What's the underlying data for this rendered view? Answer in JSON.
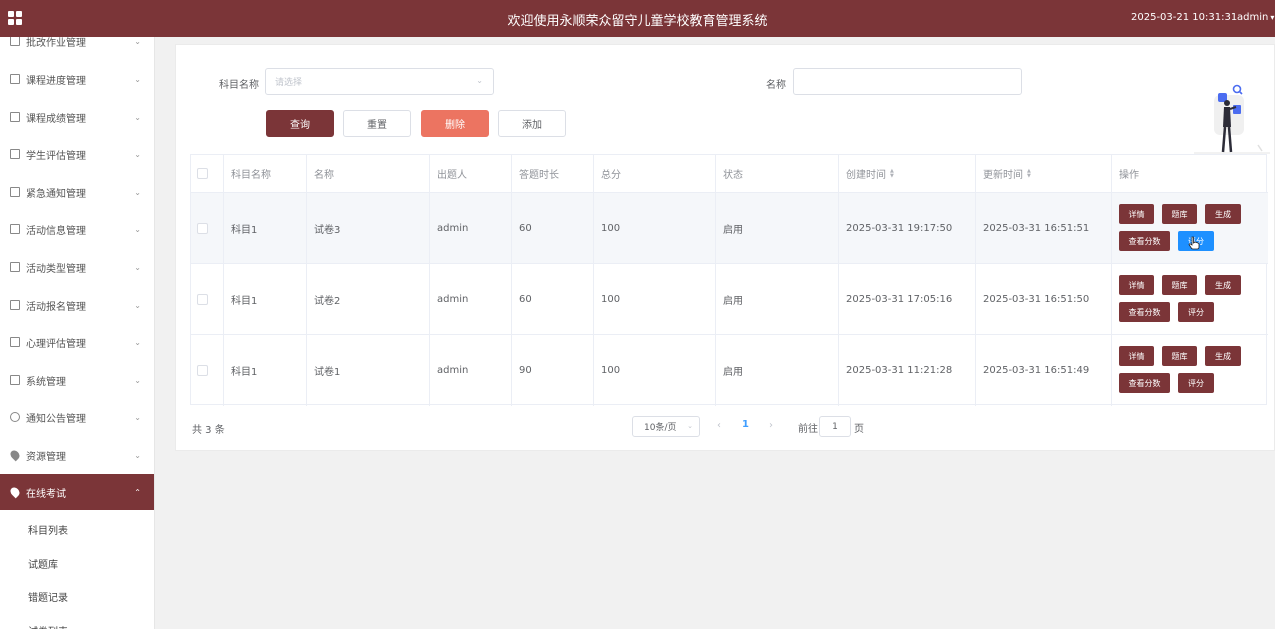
{
  "header": {
    "title": "欢迎使用永顺荣众留守儿童学校教育管理系统",
    "datetime": "2025-03-21 10:31:31",
    "user": "admin"
  },
  "sidebar": {
    "items": [
      {
        "label": "批改作业管理"
      },
      {
        "label": "课程进度管理"
      },
      {
        "label": "课程成绩管理"
      },
      {
        "label": "学生评估管理"
      },
      {
        "label": "紧急通知管理"
      },
      {
        "label": "活动信息管理"
      },
      {
        "label": "活动类型管理"
      },
      {
        "label": "活动报名管理"
      },
      {
        "label": "心理评估管理"
      },
      {
        "label": "系统管理"
      },
      {
        "label": "通知公告管理"
      },
      {
        "label": "资源管理"
      },
      {
        "label": "在线考试"
      }
    ],
    "subitems": [
      {
        "label": "科目列表"
      },
      {
        "label": "试题库"
      },
      {
        "label": "错题记录"
      },
      {
        "label": "试卷列表"
      }
    ]
  },
  "filters": {
    "subject_label": "科目名称",
    "subject_placeholder": "请选择",
    "name_label": "名称",
    "name_value": ""
  },
  "actions": {
    "query": "查询",
    "reset": "重置",
    "delete": "删除",
    "add": "添加"
  },
  "table": {
    "columns": [
      "科目名称",
      "名称",
      "出题人",
      "答题时长",
      "总分",
      "状态",
      "创建时间",
      "更新时间",
      "操作"
    ],
    "rows": [
      {
        "subject": "科目1",
        "name": "试卷3",
        "author": "admin",
        "duration": "60",
        "score": "100",
        "status": "启用",
        "created": "2025-03-31 19:17:50",
        "updated": "2025-03-31 16:51:51"
      },
      {
        "subject": "科目1",
        "name": "试卷2",
        "author": "admin",
        "duration": "60",
        "score": "100",
        "status": "启用",
        "created": "2025-03-31 17:05:16",
        "updated": "2025-03-31 16:51:50"
      },
      {
        "subject": "科目1",
        "name": "试卷1",
        "author": "admin",
        "duration": "90",
        "score": "100",
        "status": "启用",
        "created": "2025-03-31 11:21:28",
        "updated": "2025-03-31 16:51:49"
      }
    ],
    "row_ops": {
      "detail": "详情",
      "bank": "题库",
      "generate": "生成",
      "view_score": "查看分数",
      "grade": "评分"
    }
  },
  "pagination": {
    "total": "共 3 条",
    "page_size": "10条/页",
    "current": "1",
    "goto_label": "前往",
    "goto_value": "1",
    "page_unit": "页"
  },
  "colors": {
    "brand": "#7b3538",
    "danger": "#ec7461",
    "hover_button": "#1e90ff"
  }
}
